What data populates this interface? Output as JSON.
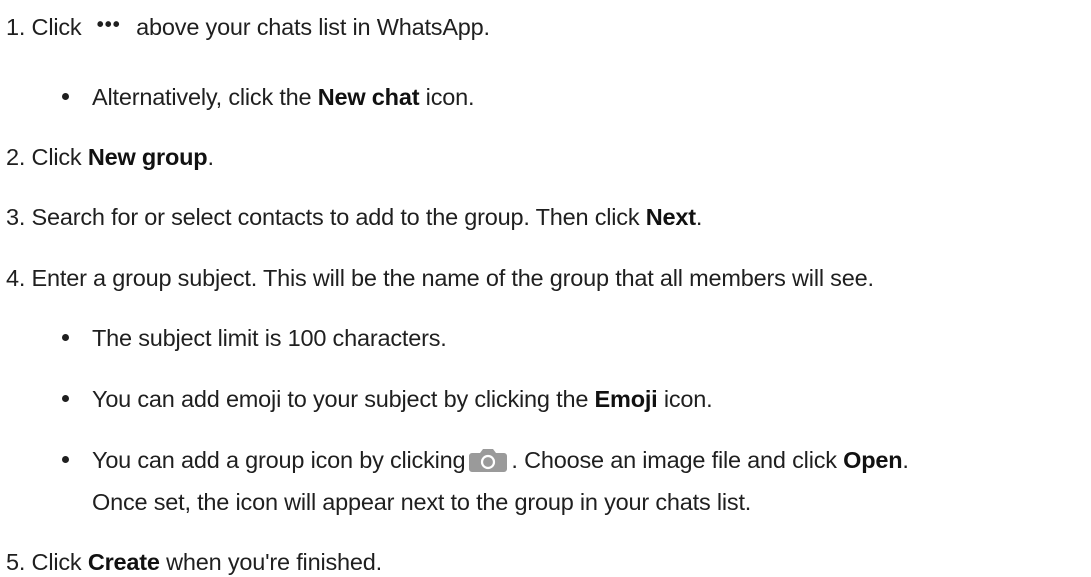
{
  "steps": [
    {
      "num": "1.",
      "pre": "Click",
      "icon": "more-options-icon",
      "icon_glyph": "•••",
      "post": "above your chats list in WhatsApp."
    },
    {
      "num": "2.",
      "pre": "Click",
      "bold": "New group",
      "post": "."
    },
    {
      "num": "3.",
      "pre": "Search for or select contacts to add to the group. Then click",
      "bold": "Next",
      "post": "."
    },
    {
      "num": "4.",
      "text": "Enter a group subject. This will be the name of the group that all members will see."
    },
    {
      "num": "5.",
      "pre": "Click",
      "bold": "Create",
      "post": "when you're finished."
    }
  ],
  "bullets": {
    "step1": {
      "pre": "Alternatively, click the",
      "bold": "New chat",
      "post": "icon."
    },
    "step4_a": {
      "text": "The subject limit is 100 characters."
    },
    "step4_b": {
      "pre": "You can add emoji to your subject by clicking the",
      "bold": "Emoji",
      "post": "icon."
    },
    "step4_c": {
      "pre": "You can add a group icon by clicking",
      "icon": "camera-icon",
      "mid": ". Choose an image file and click",
      "bold": "Open",
      "post": ".",
      "continuation": "Once set, the icon will appear next to the group in your chats list."
    }
  },
  "colors": {
    "text": "#1f1f1f",
    "camera_icon_bg": "#9a9a9a",
    "camera_icon_fg": "#ffffff"
  }
}
